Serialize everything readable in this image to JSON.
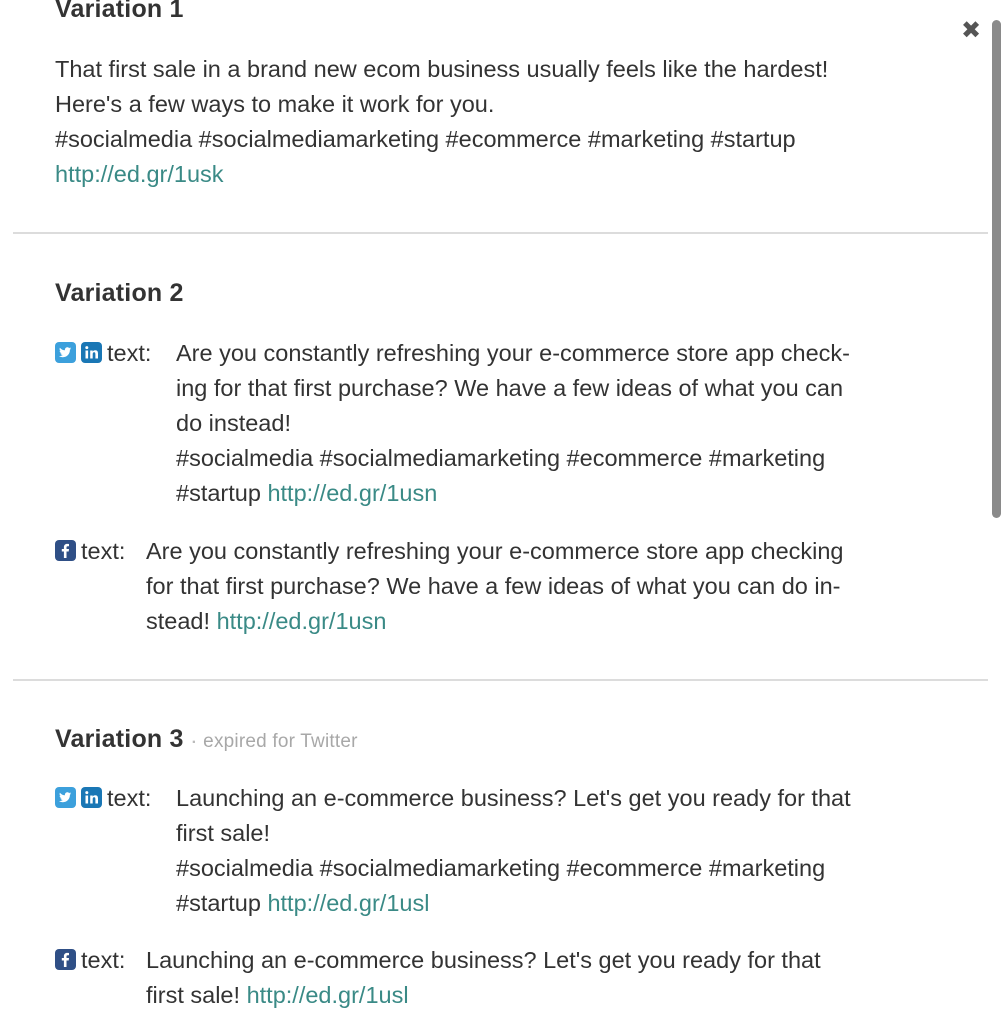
{
  "close_glyph": "✖",
  "text_prefix": "text:",
  "variations": [
    {
      "title": "Variation 1",
      "lines": [
        "That first sale in a brand new ecom business usually feels like the hardest!",
        "Here's a few ways to make it work for you.",
        "#socialmedia #socialmediamarketing #ecommerce #marketing #startup"
      ],
      "link": "http://ed.gr/1usk"
    },
    {
      "title": "Variation 2",
      "entries": [
        {
          "icons": [
            "twitter-icon",
            "linkedin-icon"
          ],
          "lines": [
            "Are you constantly refreshing your e-commerce store app check-",
            "ing for that first purchase? We have a few ideas of what you can",
            "do instead!",
            "#socialmedia #socialmediamarketing #ecommerce #marketing",
            "#startup"
          ],
          "link": "http://ed.gr/1usn"
        },
        {
          "icons": [
            "facebook-icon"
          ],
          "lines": [
            "Are you constantly refreshing your e-commerce store app checking",
            "for that first purchase? We have a few ideas of what you can do in-",
            "stead!"
          ],
          "link": "http://ed.gr/1usn"
        }
      ]
    },
    {
      "title": "Variation 3",
      "status_sep": "·",
      "status": "expired for Twitter",
      "entries": [
        {
          "icons": [
            "twitter-icon",
            "linkedin-icon"
          ],
          "lines": [
            "Launching an e-commerce business? Let's get you ready for that",
            "first sale!",
            "#socialmedia #socialmediamarketing #ecommerce #marketing",
            "#startup"
          ],
          "link": "http://ed.gr/1usl"
        },
        {
          "icons": [
            "facebook-icon"
          ],
          "lines": [
            "Launching an e-commerce business? Let's get you ready for that",
            "first sale!"
          ],
          "link": "http://ed.gr/1usl"
        }
      ]
    }
  ],
  "colors": {
    "link": "#3a8a86",
    "twitter": "#3ca0dc",
    "linkedin": "#1a77b5",
    "facebook": "#2f4f86",
    "muted": "#a8a8a8"
  }
}
